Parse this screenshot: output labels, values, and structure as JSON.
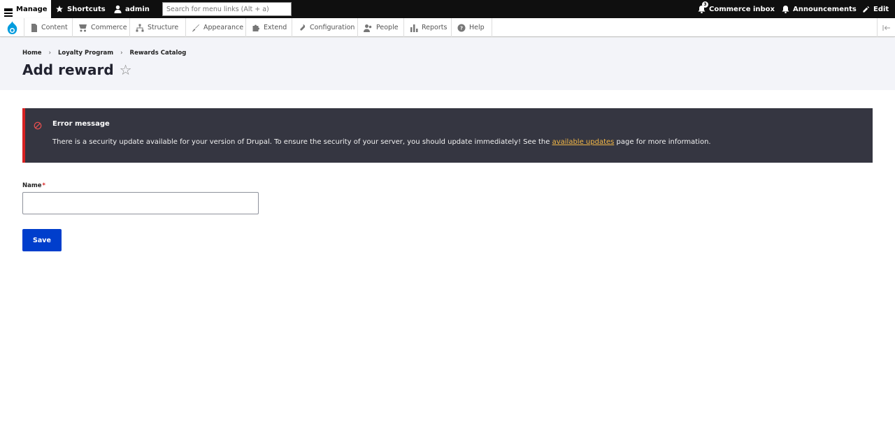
{
  "toolbar": {
    "manage": "Manage",
    "shortcuts": "Shortcuts",
    "user": "admin",
    "search_placeholder": "Search for menu links (Alt + a)",
    "inbox": "Commerce inbox",
    "inbox_count": "3",
    "announcements": "Announcements",
    "edit": "Edit"
  },
  "menu": {
    "items": [
      {
        "label": "Content",
        "icon": "document-icon"
      },
      {
        "label": "Commerce",
        "icon": "store-icon"
      },
      {
        "label": "Structure",
        "icon": "sitemap-icon"
      },
      {
        "label": "Appearance",
        "icon": "brush-icon"
      },
      {
        "label": "Extend",
        "icon": "puzzle-icon"
      },
      {
        "label": "Configuration",
        "icon": "wrench-icon"
      },
      {
        "label": "People",
        "icon": "people-icon"
      },
      {
        "label": "Reports",
        "icon": "bar-chart-icon"
      },
      {
        "label": "Help",
        "icon": "help-icon"
      }
    ]
  },
  "breadcrumb": [
    "Home",
    "Loyalty Program",
    "Rewards Catalog"
  ],
  "page": {
    "title": "Add reward"
  },
  "message": {
    "title": "Error message",
    "text_before": "There is a security update available for your version of Drupal. To ensure the security of your server, you should update immediately! See the ",
    "link": "available updates",
    "text_after": " page for more information."
  },
  "form": {
    "name_label": "Name",
    "required_mark": "*",
    "name_value": "",
    "save_label": "Save"
  },
  "colors": {
    "primary_button": "#003ecc",
    "error_accent": "#d72222",
    "message_bg": "#353641",
    "link_color": "#f3b847"
  }
}
